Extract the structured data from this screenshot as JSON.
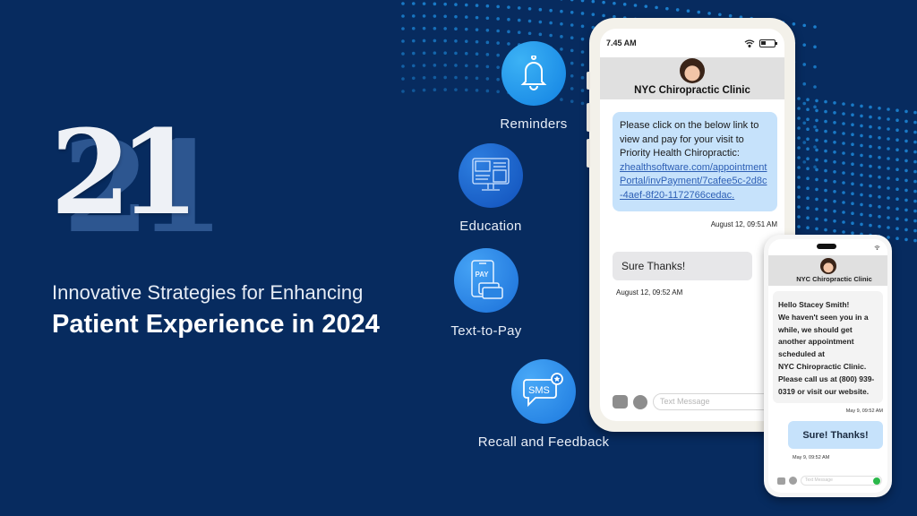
{
  "colors": {
    "background": "#072b5f",
    "dot_accent": "#1e8de0",
    "bubble_incoming": "#c6e2fb",
    "bubble_outgoing": "#e7e7e9",
    "send_green": "#2bb84a",
    "link": "#2d5fb5"
  },
  "hero": {
    "number": "21",
    "subtitle": "Innovative Strategies for Enhancing",
    "title": "Patient Experience in 2024"
  },
  "features": [
    {
      "label": "Reminders",
      "icon": "bell-icon"
    },
    {
      "label": "Education",
      "icon": "monitor-icon"
    },
    {
      "label": "Text-to-Pay",
      "icon": "pay-phone-card-icon",
      "icon_text": "PAY"
    },
    {
      "label": "Recall and Feedback",
      "icon": "sms-chat-icon",
      "icon_text": "SMS"
    }
  ],
  "phone_main": {
    "status_time": "7.45 AM",
    "status_icons": [
      "wifi-icon",
      "battery-icon"
    ],
    "contact_name": "NYC Chiropractic Clinic",
    "message_in": {
      "text": "Please click on the below link to view and pay for your visit to Priority Health Chiropractic:",
      "link": "zhealthsoftware.com/appointmentPortal/invPayment/7cafee5c-2d8c-4aef-8f20-1172766cedac.",
      "timestamp": "August 12,  09:51 AM"
    },
    "message_out": {
      "text": "Sure Thanks!",
      "timestamp": "August 12,  09:52 AM"
    },
    "input_placeholder": "Text Message"
  },
  "phone_secondary": {
    "contact_name": "NYC Chiropractic Clinic",
    "message_in": {
      "lines": [
        "Hello Stacey Smith!",
        "We haven't seen you in a while, we should get another appointment scheduled at",
        "NYC Chiropractic Clinic.",
        "Please call us at (800) 939-0319 or visit our website."
      ],
      "timestamp": "May 9,  09:52 AM"
    },
    "message_out": {
      "text": "Sure! Thanks!",
      "timestamp": "May 9,  09:52 AM"
    },
    "input_placeholder": "Text Message"
  }
}
